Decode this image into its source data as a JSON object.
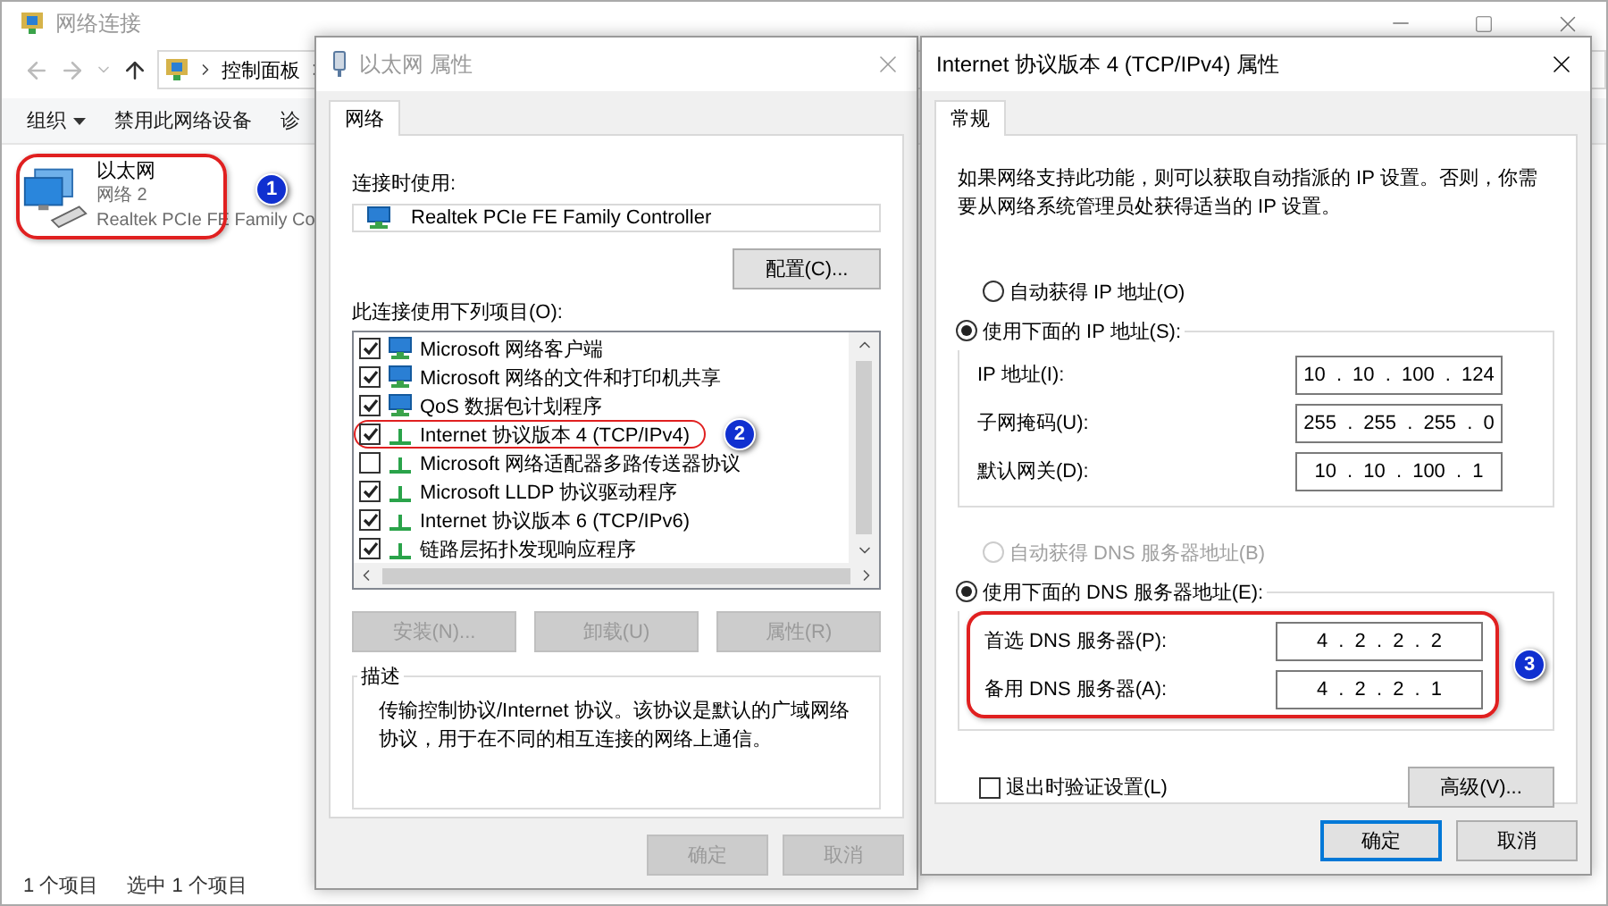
{
  "explorer": {
    "title": "网络连接",
    "address": [
      "控制面板"
    ],
    "commands": [
      {
        "label": "组织",
        "dropdown": true
      },
      {
        "label": "禁用此网络设备",
        "dropdown": false
      },
      {
        "label": "诊",
        "dropdown": false
      }
    ],
    "item": {
      "name": "以太网",
      "network": "网络 2",
      "adapter": "Realtek PCIe FE Family Co",
      "badge": "1"
    },
    "status": [
      "1 个项目",
      "选中 1 个项目"
    ]
  },
  "adapter_dialog": {
    "title": "以太网 属性",
    "active": false,
    "tabs": [
      {
        "label": "网络",
        "selected": true
      }
    ],
    "connect_using_label": "连接时使用:",
    "adapter": "Realtek PCIe FE Family Controller",
    "configure_button": "配置(C)...",
    "items_label": "此连接使用下列项目(O):",
    "items": [
      {
        "kind": "client",
        "label": "Microsoft 网络客户端",
        "checked": true
      },
      {
        "kind": "client",
        "label": "Microsoft 网络的文件和打印机共享",
        "checked": true
      },
      {
        "kind": "client",
        "label": "QoS 数据包计划程序",
        "checked": true
      },
      {
        "kind": "protocol",
        "label": "Internet 协议版本 4 (TCP/IPv4)",
        "checked": true,
        "badge": "2"
      },
      {
        "kind": "protocol",
        "label": "Microsoft 网络适配器多路传送器协议",
        "checked": false
      },
      {
        "kind": "protocol",
        "label": "Microsoft LLDP 协议驱动程序",
        "checked": true
      },
      {
        "kind": "protocol",
        "label": "Internet 协议版本 6 (TCP/IPv6)",
        "checked": true
      },
      {
        "kind": "protocol",
        "label": "链路层拓扑发现响应程序",
        "checked": true
      }
    ],
    "item_buttons": [
      {
        "label": "安装(N)...",
        "disabled": true
      },
      {
        "label": "卸载(U)",
        "disabled": true
      },
      {
        "label": "属性(R)",
        "disabled": true
      }
    ],
    "description_title": "描述",
    "description": "传输控制协议/Internet 协议。该协议是默认的广域网络协议，用于在不同的相互连接的网络上通信。",
    "footer_buttons": [
      {
        "label": "确定",
        "disabled": true,
        "focused": false
      },
      {
        "label": "取消",
        "disabled": true,
        "focused": false
      }
    ]
  },
  "ipv4_dialog": {
    "title": "Internet 协议版本 4 (TCP/IPv4) 属性",
    "active": true,
    "tabs": [
      {
        "label": "常规",
        "selected": true
      }
    ],
    "intro": "如果网络支持此功能，则可以获取自动指派的 IP 设置。否则，你需要从网络系统管理员处获得适当的 IP 设置。",
    "ip_modes": [
      {
        "label": "自动获得 IP 地址(O)",
        "selected": false,
        "disabled": false
      },
      {
        "label": "使用下面的 IP 地址(S):",
        "selected": true,
        "disabled": false
      }
    ],
    "ip_fields": [
      {
        "label": "IP 地址(I):",
        "value": "10 . 10 . 100 . 124"
      },
      {
        "label": "子网掩码(U):",
        "value": "255 . 255 . 255 . 0"
      },
      {
        "label": "默认网关(D):",
        "value": "10 . 10 . 100 . 1"
      }
    ],
    "dns_modes": [
      {
        "label": "自动获得 DNS 服务器地址(B)",
        "selected": false,
        "disabled": true
      },
      {
        "label": "使用下面的 DNS 服务器地址(E):",
        "selected": true,
        "disabled": false
      }
    ],
    "dns_fields": [
      {
        "label": "首选 DNS 服务器(P):",
        "value": "4 . 2 . 2 . 2"
      },
      {
        "label": "备用 DNS 服务器(A):",
        "value": "4 . 2 . 2 . 1"
      }
    ],
    "dns_badge": "3",
    "validate": {
      "label": "退出时验证设置(L)",
      "checked": false
    },
    "advanced_button": "高级(V)...",
    "footer_buttons": [
      {
        "label": "确定",
        "disabled": false,
        "focused": true
      },
      {
        "label": "取消",
        "disabled": false,
        "focused": false
      }
    ]
  }
}
